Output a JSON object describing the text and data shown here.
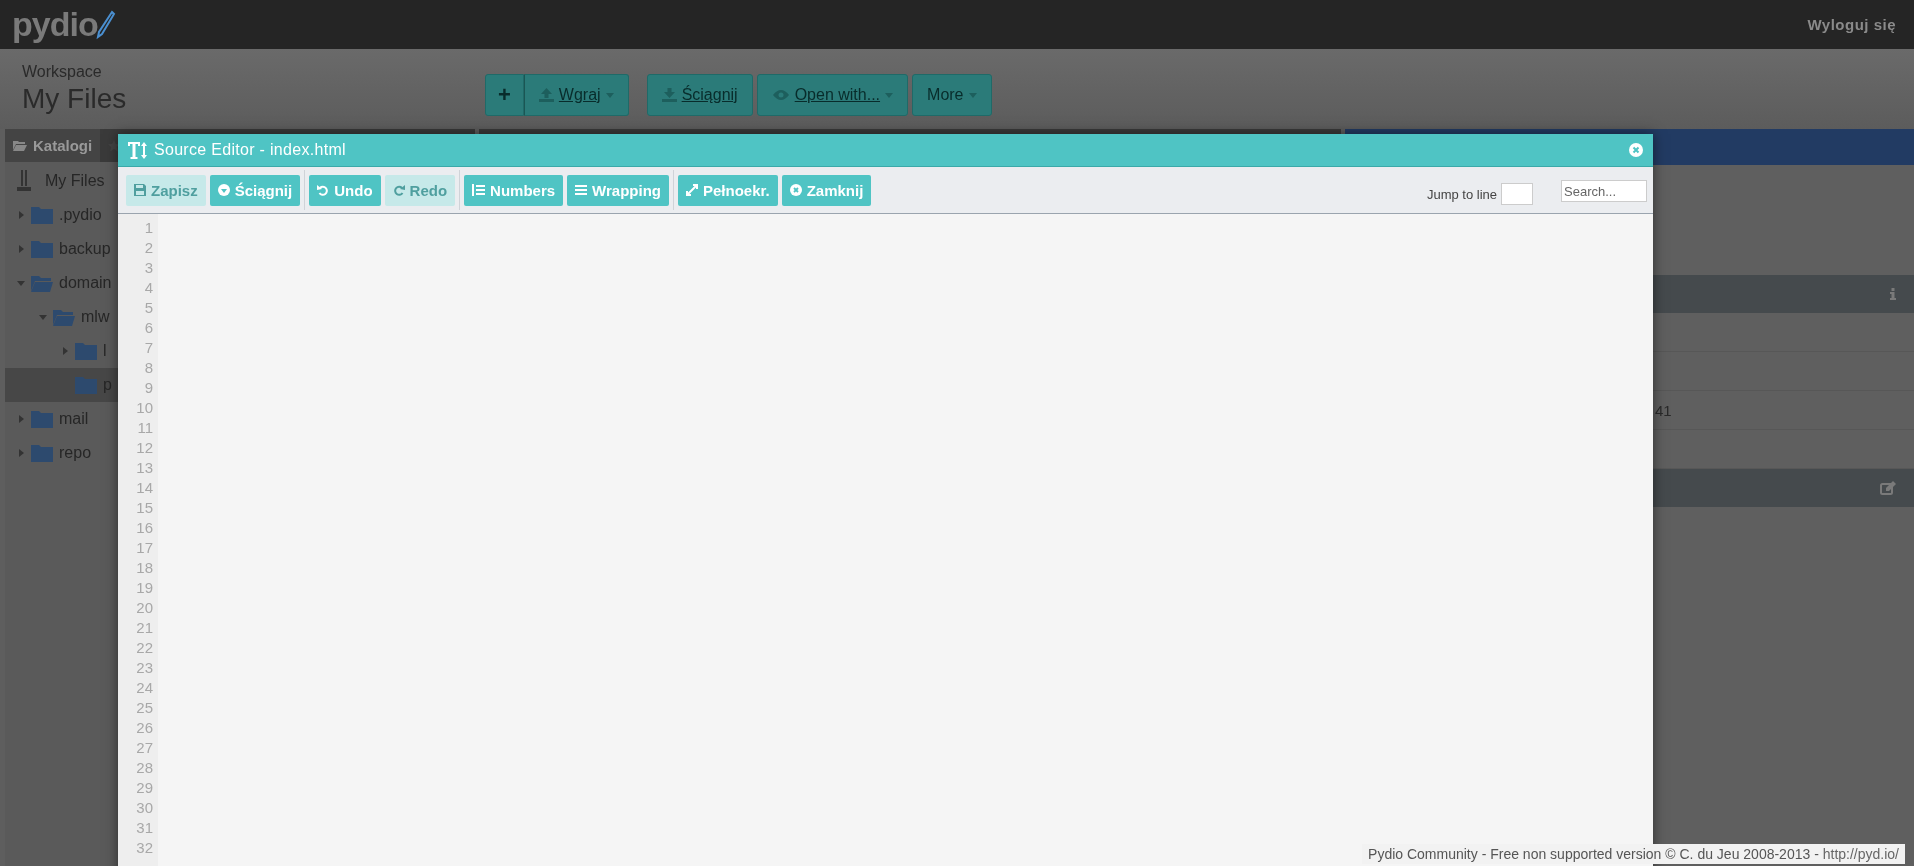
{
  "top_bar": {
    "logo": "pydio",
    "logout": "Wyloguj się"
  },
  "header": {
    "workspace_label": "Workspace",
    "title": "My Files"
  },
  "toolbar": [
    {
      "label": "+",
      "kind": "icon",
      "caret": false,
      "underlined": false
    },
    {
      "label": "Wgraj",
      "kind": "upload",
      "caret": true,
      "underlined": true
    },
    {
      "label": "Ściągnij",
      "kind": "download",
      "caret": false,
      "underlined": true
    },
    {
      "label": "Open with...",
      "kind": "eye",
      "caret": true,
      "underlined": true
    },
    {
      "label": "More",
      "kind": "plain",
      "caret": true,
      "underlined": false
    }
  ],
  "sidebar": {
    "tab": "Katalogi",
    "root": "My Files",
    "items": [
      {
        "name": ".pydio",
        "expanded": false,
        "selected": false
      },
      {
        "name": "backup",
        "expanded": false,
        "selected": false
      },
      {
        "name": "domain",
        "expanded": true,
        "selected": false,
        "children": [
          {
            "name": "mlw",
            "expanded": true,
            "selected": false,
            "children": [
              {
                "name": "l",
                "expanded": false,
                "selected": false
              },
              {
                "name": "p",
                "selected": true,
                "leaf": true
              }
            ]
          }
        ]
      },
      {
        "name": "mail",
        "expanded": false,
        "selected": false
      },
      {
        "name": "repo",
        "expanded": false,
        "selected": false
      }
    ]
  },
  "info_panel": {
    "rows": [
      "",
      "",
      "41",
      ""
    ]
  },
  "editor": {
    "title": "Source Editor - index.html",
    "buttons": [
      [
        {
          "label": "Zapisz",
          "kind": "save",
          "disabled": true
        },
        {
          "label": "Ściągnij",
          "kind": "download",
          "disabled": false
        }
      ],
      [
        {
          "label": "Undo",
          "kind": "undo",
          "disabled": false
        },
        {
          "label": "Redo",
          "kind": "redo",
          "disabled": true
        }
      ],
      [
        {
          "label": "Numbers",
          "kind": "numbers",
          "disabled": false
        },
        {
          "label": "Wrapping",
          "kind": "wrap",
          "disabled": false
        }
      ],
      [
        {
          "label": "Pełnoekr.",
          "kind": "fullscreen",
          "disabled": false
        },
        {
          "label": "Zamknij",
          "kind": "close",
          "disabled": false
        }
      ]
    ],
    "jump_label": "Jump to line",
    "search_placeholder": "Search...",
    "line_numbers": [
      "1",
      "2",
      "3",
      "4",
      "5",
      "6",
      "7",
      "8",
      "9",
      "10",
      "11",
      "12",
      "13",
      "14",
      "15",
      "16",
      "17",
      "18",
      "19",
      "20",
      "21",
      "22",
      "23",
      "24",
      "25",
      "26",
      "27",
      "28",
      "29",
      "30",
      "31",
      "32"
    ]
  },
  "footer": {
    "text": "Pydio Community - Free non supported version © C. du Jeu 2008-2013 - ",
    "link": "http://pyd.io/"
  }
}
